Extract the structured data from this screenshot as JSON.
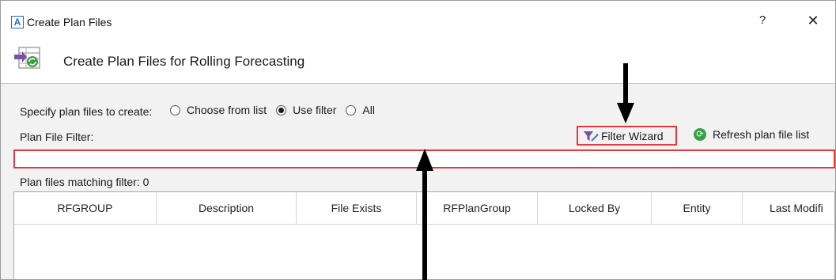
{
  "window": {
    "title": "Create Plan Files",
    "app_icon_letter": "A",
    "help_label": "?",
    "close_label": "✕"
  },
  "header": {
    "title": "Create Plan Files for Rolling Forecasting",
    "icon": "plan-files-refresh-icon"
  },
  "form": {
    "specify_label": "Specify plan files to create:",
    "options": [
      {
        "label": "Choose from list",
        "selected": false
      },
      {
        "label": "Use filter",
        "selected": true
      },
      {
        "label": "All",
        "selected": false
      }
    ],
    "filter_label": "Plan File Filter:",
    "filter_value": "",
    "filter_wizard_label": "Filter Wizard",
    "refresh_label": "Refresh plan file list",
    "matching_label": "Plan files matching filter: 0"
  },
  "grid": {
    "columns": [
      "RFGROUP",
      "Description",
      "File Exists",
      "RFPlanGroup",
      "Locked By",
      "Entity",
      "Last Modifi"
    ]
  },
  "colors": {
    "highlight": "#e0393e",
    "refresh_icon": "#3a9d4a",
    "filter_icon": "#7b4ea8",
    "app_icon": "#1e6bd0"
  }
}
